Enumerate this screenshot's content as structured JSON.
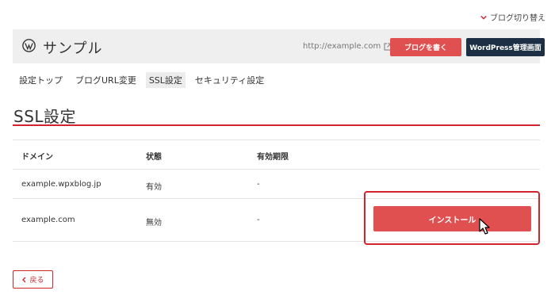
{
  "top": {
    "blog_switch_label": "ブログ切り替え"
  },
  "header": {
    "site_name": "サンプル",
    "site_url": "http://example.com",
    "write_button": "ブログを書く",
    "admin_button": "WordPress管理画面"
  },
  "tabs": [
    {
      "label": "設定トップ",
      "active": false
    },
    {
      "label": "ブログURL変更",
      "active": false
    },
    {
      "label": "SSL設定",
      "active": true
    },
    {
      "label": "セキュリティ設定",
      "active": false
    }
  ],
  "page": {
    "title": "SSL設定"
  },
  "table": {
    "headers": {
      "domain": "ドメイン",
      "status": "状態",
      "expiry": "有効期限"
    },
    "rows": [
      {
        "domain": "example.wpxblog.jp",
        "status": "有効",
        "expiry": "-"
      },
      {
        "domain": "example.com",
        "status": "無効",
        "expiry": "-"
      }
    ]
  },
  "actions": {
    "install_button": "インストール",
    "back_button": "戻る"
  },
  "colors": {
    "accent_red": "#e05050",
    "rule_red": "#d1242c",
    "admin_navy": "#1c2f45",
    "header_bg": "#efefef"
  },
  "icons": {
    "switch": "chevron-down-icon",
    "logo": "wordpress-logo-icon",
    "external": "external-link-icon",
    "back": "chevron-left-icon",
    "cursor": "mouse-pointer-icon"
  }
}
